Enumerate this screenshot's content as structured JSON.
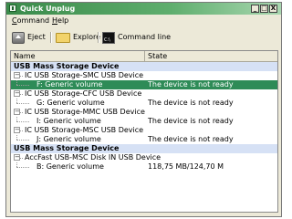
{
  "window": {
    "title": "Quick Unplug",
    "buttons": {
      "minimize": "_",
      "maximize": "□",
      "close": "X"
    }
  },
  "menu": {
    "items": [
      "Command",
      "Help"
    ]
  },
  "toolbar": {
    "eject_label": "Eject",
    "explore_label": "Explore",
    "cmd_label": "Command line",
    "icons": {
      "eject": "eject-icon",
      "explore": "folder-icon",
      "cmd": "command-prompt-icon"
    }
  },
  "list": {
    "columns": [
      "Name",
      "State"
    ],
    "rows": [
      {
        "type": "group",
        "name": "USB Mass Storage Device",
        "state": ""
      },
      {
        "type": "device",
        "name": "IC USB Storage-SMC USB Device",
        "state": ""
      },
      {
        "type": "volume",
        "name": "F: Generic volume",
        "state": "The device is not ready",
        "selected": true
      },
      {
        "type": "device",
        "name": "IC USB Storage-CFC USB Device",
        "state": ""
      },
      {
        "type": "volume",
        "name": "G: Generic volume",
        "state": "The device is not ready"
      },
      {
        "type": "device",
        "name": "IC USB Storage-MMC USB Device",
        "state": ""
      },
      {
        "type": "volume",
        "name": "I: Generic volume",
        "state": "The device is not ready"
      },
      {
        "type": "device",
        "name": "IC USB Storage-MSC USB Device",
        "state": ""
      },
      {
        "type": "volume",
        "name": "J: Generic volume",
        "state": "The device is not ready"
      },
      {
        "type": "group",
        "name": "USB Mass Storage Device",
        "state": ""
      },
      {
        "type": "device",
        "name": "AccFast  USB-MSC Disk IN USB Device",
        "state": ""
      },
      {
        "type": "volume",
        "name": "B: Generic volume",
        "state": "118,75 MB/124,70 M"
      }
    ]
  },
  "colors": {
    "title_bar": "#3a8a4a",
    "selection": "#2e8b57",
    "group_row": "#d6e1f5"
  }
}
